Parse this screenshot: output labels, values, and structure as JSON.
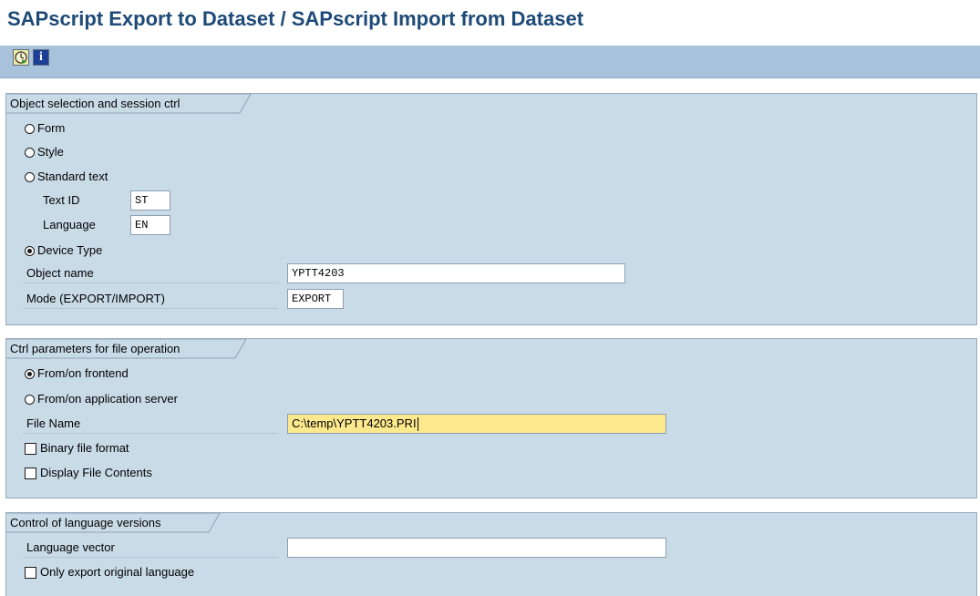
{
  "title": "SAPscript Export to Dataset / SAPscript Import from Dataset",
  "toolbar": {
    "execute_icon": "execute-icon",
    "info_icon": "info-icon",
    "info_glyph": "i"
  },
  "panel1": {
    "header": "Object selection and session ctrl",
    "form_label": "Form",
    "style_label": "Style",
    "standard_text_label": "Standard text",
    "text_id_label": "Text ID",
    "text_id_value": "ST",
    "language_label": "Language",
    "language_value": "EN",
    "device_type_label": "Device Type",
    "object_name_label": "Object name",
    "object_name_value": "YPTT4203",
    "mode_label": "Mode (EXPORT/IMPORT)",
    "mode_value": "EXPORT"
  },
  "panel2": {
    "header": "Ctrl parameters for file operation",
    "frontend_label": "From/on frontend",
    "app_server_label": "From/on application server",
    "file_name_label": "File Name",
    "file_name_value": "C:\\temp\\YPTT4203.PRI",
    "binary_label": "Binary file format",
    "display_label": "Display File Contents"
  },
  "panel3": {
    "header": "Control of language versions",
    "language_vector_label": "Language vector",
    "language_vector_value": "",
    "only_export_label": "Only export original language"
  },
  "colors": {
    "title": "#1e4a78",
    "toolbar": "#a9c2dc",
    "panel": "#cadbe8",
    "focused_input": "#fde98d"
  }
}
